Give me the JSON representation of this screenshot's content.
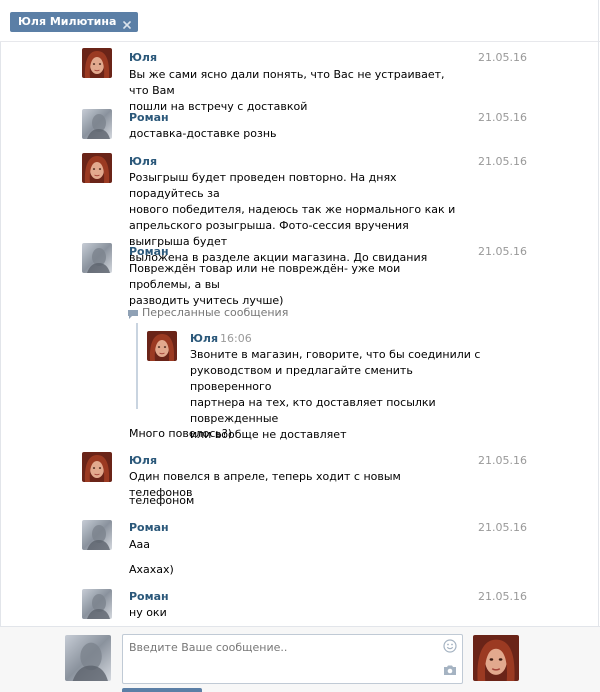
{
  "tab": {
    "title": "Юля Милютина"
  },
  "forwarded": {
    "header": "Пересланные сообщения",
    "author": "Юля",
    "time": "16:06",
    "lines": [
      "Звоните в магазин, говорите, что бы соединили с",
      "руководством и предлагайте сменить проверенного",
      "партнера на тех, кто доставляет посылки поврежденные",
      "или вообще не доставляет"
    ]
  },
  "messages": [
    {
      "author": "Юля",
      "date": "21.05.16",
      "lines": [
        "Вы же сами ясно дали понять, что Вас не устраивает, что Вам",
        "пошли на встречу с доставкой"
      ]
    },
    {
      "author": "Роман",
      "date": "21.05.16",
      "lines": [
        "доставка-доставке рознь"
      ]
    },
    {
      "author": "Юля",
      "date": "21.05.16",
      "lines": [
        "Розыгрыш будет проведен повторно. На днях порадуйтесь за",
        "нового победителя, надеюсь так же нормального как и",
        "апрельского розыгрыша. Фото-сессия вручения выигрыша будет",
        "выложена в разделе акции магазина. До свидания"
      ]
    },
    {
      "author": "Роман",
      "date": "21.05.16",
      "lines": [
        "Повреждён товар или не повреждён- уже мои проблемы, а вы",
        "разводить учитесь лучше)"
      ],
      "after": "Много повелось?)"
    },
    {
      "author": "Юля",
      "date": "21.05.16",
      "lines": [
        "Один повелся в апреле, теперь ходит с новым телефонов"
      ],
      "after": "телефоном"
    },
    {
      "author": "Роман",
      "date": "21.05.16",
      "lines": [
        "Ааа"
      ],
      "after": "Ахахах)"
    },
    {
      "author": "Роман",
      "date": "21.05.16",
      "lines": [
        "ну оки"
      ]
    }
  ],
  "composer": {
    "placeholder": "Введите Ваше сообщение.."
  },
  "icons": {
    "close": "close-icon",
    "forward": "speech-bubble-icon",
    "emoji": "smiley-icon",
    "camera": "camera-icon"
  },
  "colors": {
    "tab_bg": "#5b7fa6",
    "author": "#2b587a",
    "date": "#999999",
    "forward_bar": "#c9d4e0"
  }
}
